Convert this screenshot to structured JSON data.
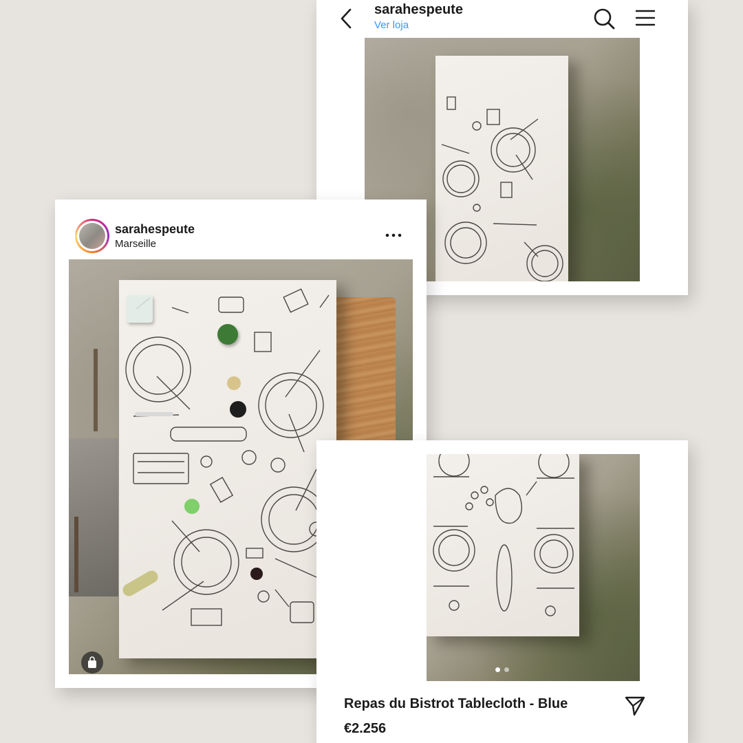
{
  "top_post": {
    "username": "sarahespeute",
    "shop_link": "Ver loja",
    "accent": "#3897f0"
  },
  "main_post": {
    "username": "sarahespeute",
    "location": "Marseille",
    "more_label": "•••"
  },
  "product_post": {
    "title": "Repas du Bistrot Tablecloth - Blue",
    "price": "€2.256",
    "carousel_dots": 2,
    "active_dot": 1
  },
  "icons": {
    "back": "chevron-left-icon",
    "search": "search-icon",
    "menu": "hamburger-menu-icon",
    "more": "more-options-icon",
    "shopping": "shopping-bag-icon",
    "share": "send-icon"
  }
}
